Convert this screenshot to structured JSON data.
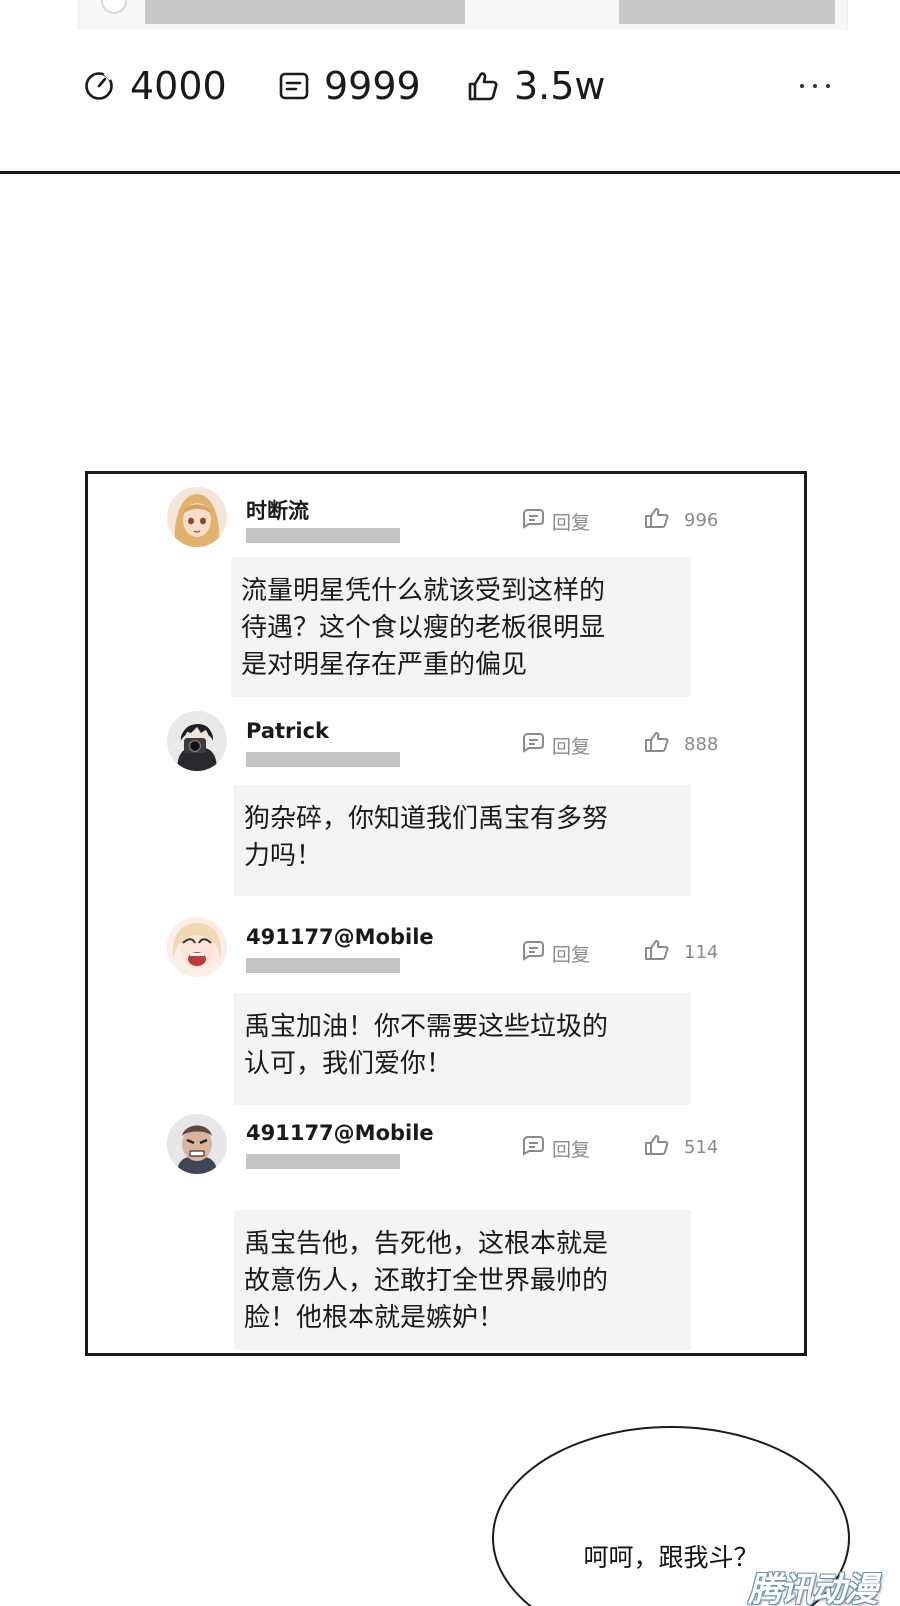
{
  "post_stats": {
    "views": "4000",
    "comments": "9999",
    "likes": "3.5w"
  },
  "comments": [
    {
      "username": "时断流",
      "reply_label": "回复",
      "like_count": "996",
      "text": "流量明星凭什么就该受到这样的\n待遇？这个食以瘦的老板很明显\n是对明星存在严重的偏见",
      "avatar": "blonde-girl-avatar"
    },
    {
      "username": "Patrick",
      "reply_label": "回复",
      "like_count": "888",
      "text": "狗杂碎，你知道我们禹宝有多努\n力吗！",
      "avatar": "photographer-avatar"
    },
    {
      "username": "491177@Mobile",
      "reply_label": "回复",
      "like_count": "114",
      "text": "禹宝加油！你不需要这些垃圾的\n认可，我们爱你！",
      "avatar": "screaming-girl-avatar"
    },
    {
      "username": "491177@Mobile",
      "reply_label": "回复",
      "like_count": "514",
      "text": "禹宝告他，告死他，这根本就是\n故意伤人，还敢打全世界最帅的\n脸！他根本就是嫉妒！",
      "avatar": "angry-man-avatar"
    }
  ],
  "speech_bubble": {
    "text": "呵呵，跟我斗？"
  },
  "watermark": "腾讯动漫",
  "colors": {
    "border": "#1a1a1a",
    "bubble_bg": "#f4f4f4",
    "muted_text": "#8a8a8a",
    "placeholder_bar": "#c4c4c4"
  }
}
